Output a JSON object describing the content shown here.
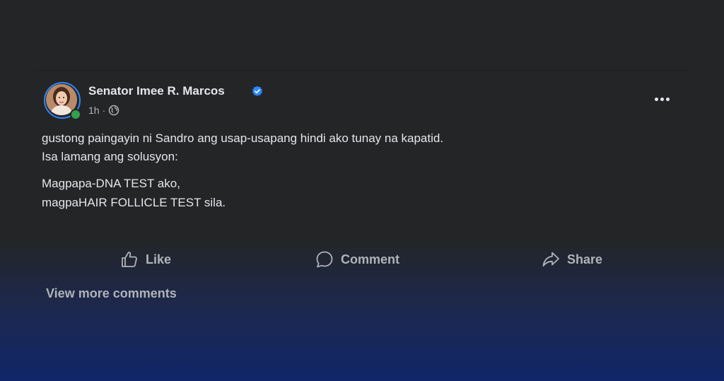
{
  "post": {
    "author": "Senator Imee R. Marcos",
    "time": "1h",
    "separator": "·",
    "privacy_icon": "globe-icon",
    "verified_icon": "verified-badge-icon",
    "more_icon": "more-options-icon",
    "text_lines": [
      "gustong paingayin ni Sandro ang usap-usapang hindi ako tunay na kapatid.",
      "Isa lamang ang solusyon:",
      "Magpapa-DNA TEST ako,",
      "magpaHAIR FOLLICLE TEST sila."
    ]
  },
  "actions": {
    "like": "Like",
    "comment": "Comment",
    "share": "Share"
  },
  "comments": {
    "view_more": "View more comments"
  },
  "colors": {
    "background": "#242526",
    "accent_blue": "#2d88ff",
    "online_green": "#31a24c",
    "primary_text": "#e4e6eb",
    "secondary_text": "#b0b3b8"
  }
}
